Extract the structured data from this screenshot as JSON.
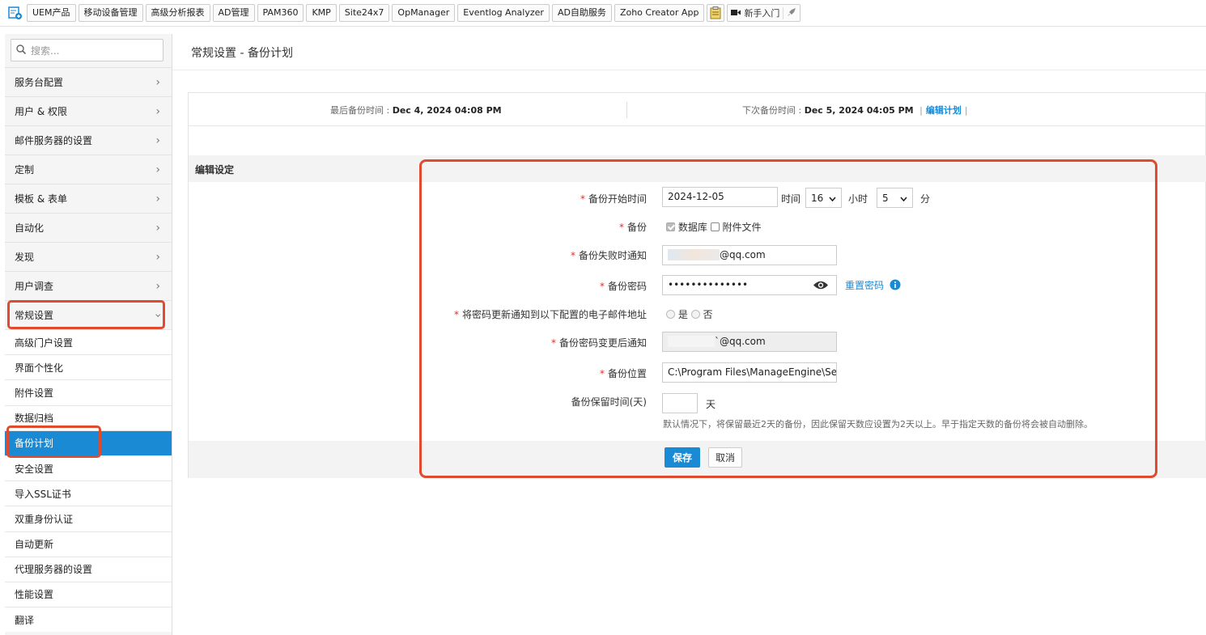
{
  "toolbar": {
    "items": [
      "UEM产品",
      "移动设备管理",
      "高级分析报表",
      "AD管理",
      "PAM360",
      "KMP",
      "Site24x7",
      "OpManager",
      "Eventlog Analyzer",
      "AD自助服务",
      "Zoho Creator App"
    ],
    "getting_started": "新手入门"
  },
  "sidebar": {
    "search_placeholder": "搜索...",
    "menu": [
      "服务台配置",
      "用户 & 权限",
      "邮件服务器的设置",
      "定制",
      "模板 & 表单",
      "自动化",
      "发现",
      "用户调查",
      "常规设置"
    ],
    "sub_items": [
      "高级门户设置",
      "界面个性化",
      "附件设置",
      "数据归档",
      "备份计划",
      "安全设置",
      "导入SSL证书",
      "双重身份认证",
      "自动更新",
      "代理服务器的设置",
      "性能设置",
      "翻译"
    ],
    "active_sub": "备份计划"
  },
  "page": {
    "title": "常规设置 - 备份计划",
    "last_backup_label": "最后备份时间 : ",
    "last_backup_value": "Dec 4, 2024 04:08 PM",
    "next_backup_label": "下次备份时间 : ",
    "next_backup_value": "Dec 5, 2024 04:05 PM",
    "edit_schedule": "编辑计划",
    "pipe": "|",
    "section_title": "编辑设定"
  },
  "form": {
    "start_time_label": "备份开始时间",
    "start_date": "2024-12-05",
    "time_label": "时间",
    "hour": "16",
    "hour_label": "小时",
    "minute": "5",
    "minute_label": "分",
    "backup_label": "备份",
    "database_label": "数据库",
    "attachments_label": "附件文件",
    "failure_notify_label": "备份失败时通知",
    "failure_email": "@qq.com",
    "password_label": "备份密码",
    "password_value": "••••••••••••••",
    "reset_password": "重置密码",
    "notify_update_label": "将密码更新通知到以下配置的电子邮件地址",
    "yes": "是",
    "no": "否",
    "change_notify_label": "备份密码变更后通知",
    "change_email": "`@qq.com",
    "location_label": "备份位置",
    "location_value": "C:\\Program Files\\ManageEngine\\ServiceDesk",
    "retention_label": "备份保留时间(天)",
    "retention_value": "",
    "days_unit": "天",
    "retention_hint": "默认情况下，将保留最近2天的备份，因此保留天数应设置为2天以上。早于指定天数的备份将会被自动删除。",
    "save": "保存",
    "cancel": "取消"
  },
  "colors": {
    "accent": "#1a8ad4",
    "highlight": "#e04a2f",
    "required": "#e0302a"
  }
}
